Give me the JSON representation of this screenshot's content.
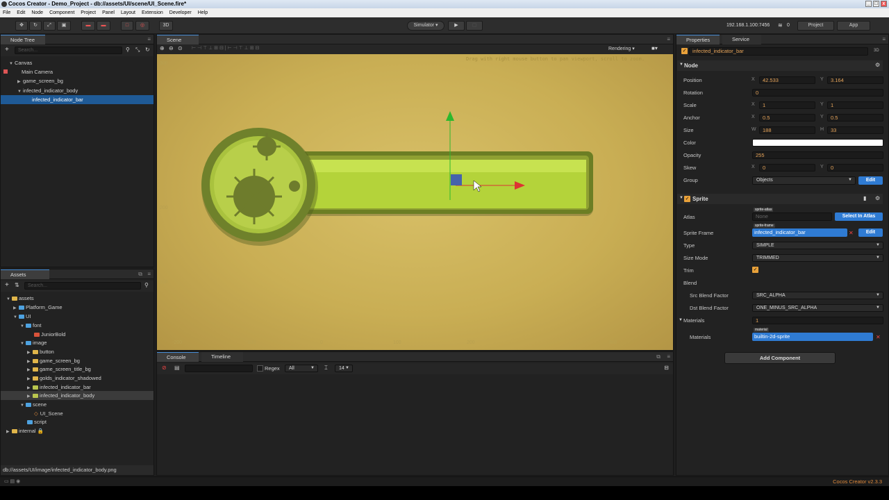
{
  "window": {
    "title": "Cocos Creator - Demo_Project - db://assets/UI/scene/UI_Scene.fire*"
  },
  "menu": [
    "File",
    "Edit",
    "Node",
    "Component",
    "Project",
    "Panel",
    "Layout",
    "Extension",
    "Developer",
    "Help"
  ],
  "toolbar": {
    "mode_3d": "3D",
    "simulator": "Simulator ▾",
    "play": "▶",
    "ip": "192.168.1.100:7456",
    "wifi_count": "0",
    "project_btn": "Project",
    "app_btn": "App"
  },
  "node_tree": {
    "tab": "Node Tree",
    "search_placeholder": "Search...",
    "items": [
      {
        "label": "Canvas"
      },
      {
        "label": "Main Camera"
      },
      {
        "label": "game_screen_bg"
      },
      {
        "label": "infected_indicator_body"
      },
      {
        "label": "infected_indicator_bar"
      }
    ]
  },
  "scene": {
    "tab": "Scene",
    "rendering": "Rendering",
    "hint": "Drag with right mouse button to pan viewport, scroll to zoom.",
    "ruler_left": [
      "300",
      "200",
      "100"
    ],
    "ruler_bottom": [
      "-200",
      "-100",
      "0",
      "100",
      "200",
      "300"
    ]
  },
  "assets": {
    "tab": "Assets",
    "search_placeholder": "Search...",
    "items": [
      {
        "label": "assets"
      },
      {
        "label": "Platform_Game"
      },
      {
        "label": "UI"
      },
      {
        "label": "font"
      },
      {
        "label": "JuniorBold"
      },
      {
        "label": "image"
      },
      {
        "label": "button"
      },
      {
        "label": "game_screen_bg"
      },
      {
        "label": "game_screen_title_bg"
      },
      {
        "label": "golds_indicator_shadowed"
      },
      {
        "label": "infected_indicator_bar"
      },
      {
        "label": "infected_indicator_body"
      },
      {
        "label": "scene"
      },
      {
        "label": "UI_Scene"
      },
      {
        "label": "script"
      },
      {
        "label": "internal 🔒"
      }
    ],
    "path": "db://assets/UI/image/infected_indicator_body.png"
  },
  "console": {
    "tab_console": "Console",
    "tab_timeline": "Timeline",
    "regex": "Regex",
    "filter": "All",
    "font_size": "14"
  },
  "properties": {
    "tab": "Properties",
    "tab_service": "Service",
    "node_name": "infected_indicator_bar",
    "mode": "3D",
    "node_section": "Node",
    "position": {
      "label": "Position",
      "x": "42.533",
      "y": "3.164"
    },
    "rotation": {
      "label": "Rotation",
      "value": "0"
    },
    "scale": {
      "label": "Scale",
      "x": "1",
      "y": "1"
    },
    "anchor": {
      "label": "Anchor",
      "x": "0.5",
      "y": "0.5"
    },
    "size": {
      "label": "Size",
      "w": "188",
      "h": "33"
    },
    "color": {
      "label": "Color",
      "hex": "#ffffff"
    },
    "opacity": {
      "label": "Opacity",
      "value": "255"
    },
    "skew": {
      "label": "Skew",
      "x": "0",
      "y": "0"
    },
    "group": {
      "label": "Group",
      "value": "Objects",
      "edit": "Edit"
    },
    "sprite_section": "Sprite",
    "atlas": {
      "label": "Atlas",
      "tag": "sprite-atlas",
      "value": "None",
      "btn": "Select In Atlas"
    },
    "sprite_frame": {
      "label": "Sprite Frame",
      "tag": "sprite-frame",
      "value": "infected_indicator_bar",
      "edit": "Edit"
    },
    "type": {
      "label": "Type",
      "value": "SIMPLE"
    },
    "size_mode": {
      "label": "Size Mode",
      "value": "TRIMMED"
    },
    "trim": {
      "label": "Trim"
    },
    "blend": {
      "label": "Blend"
    },
    "src_blend": {
      "label": "Src Blend Factor",
      "value": "SRC_ALPHA"
    },
    "dst_blend": {
      "label": "Dst Blend Factor",
      "value": "ONE_MINUS_SRC_ALPHA"
    },
    "materials_section": {
      "label": "Materials",
      "count": "1"
    },
    "materials": {
      "label": "Materials",
      "tag": "material",
      "value": "builtin-2d-sprite"
    },
    "add_component": "Add Component"
  },
  "status": {
    "version": "Cocos Creator v2.3.3"
  },
  "colors": {
    "accent": "#2f7bd3",
    "selection": "#1f5a96",
    "canvas": "#c9ae54",
    "version": "#e08a3c"
  }
}
